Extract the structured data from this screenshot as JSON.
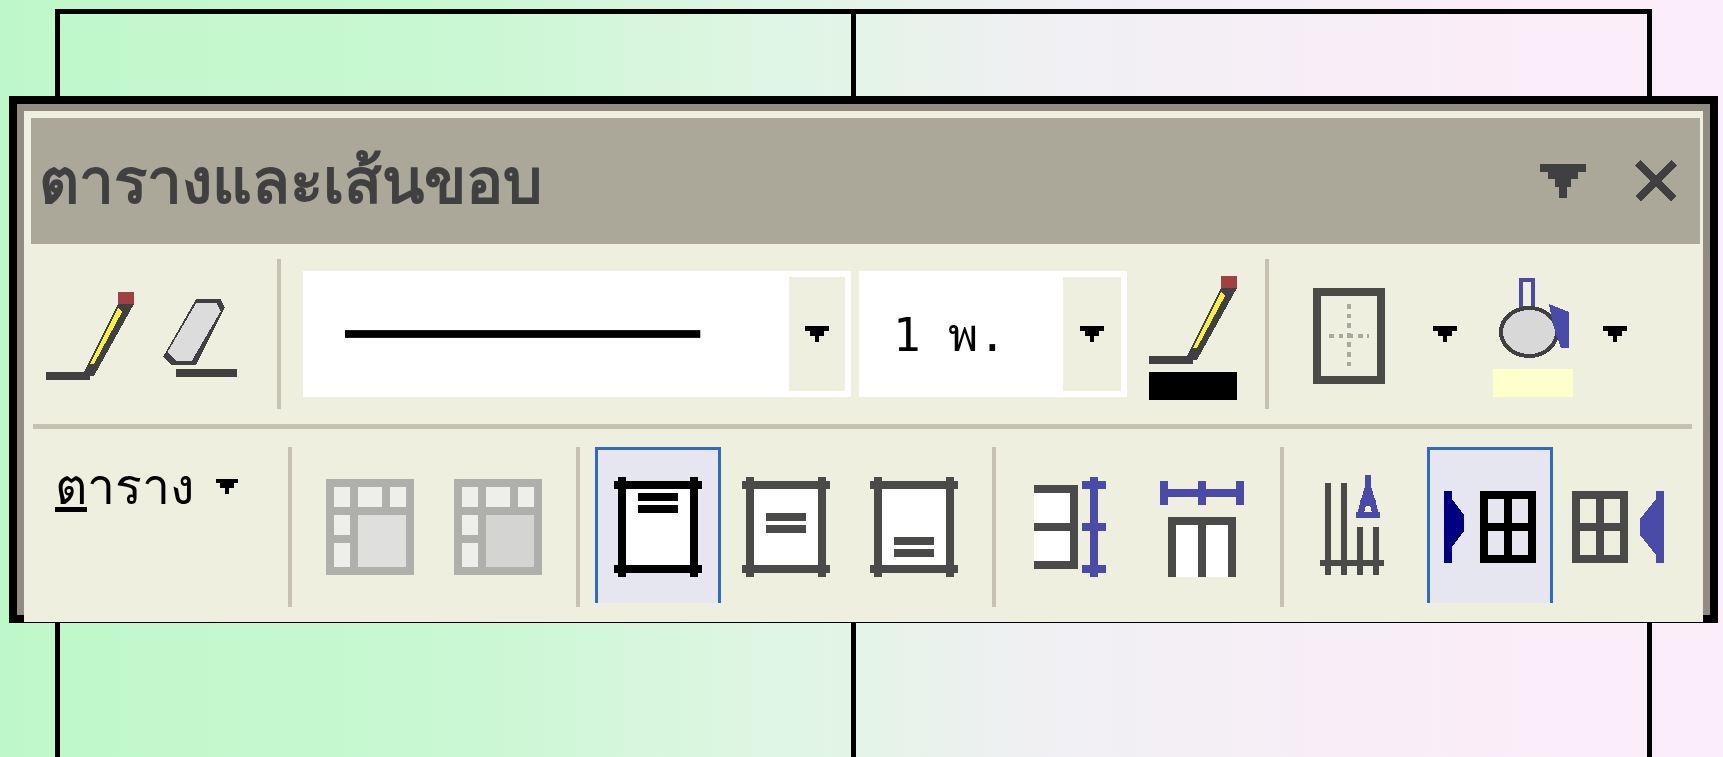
{
  "window": {
    "title": "ตารางและเส้นขอบ"
  },
  "rows": [
    {
      "groups": [
        {
          "items": [
            {
              "kind": "pencil",
              "selected": false,
              "disabled": false
            },
            {
              "kind": "eraser",
              "selected": false,
              "disabled": false
            }
          ]
        },
        {
          "items": [
            {
              "kind": "style"
            },
            {
              "kind": "weight",
              "value": "1 พ."
            },
            {
              "kind": "pen",
              "selected": false,
              "disabled": false,
              "color": "#000000"
            }
          ]
        },
        {
          "items": [
            {
              "kind": "borders",
              "selected": false,
              "disabled": false
            },
            {
              "kind": "shading",
              "selected": false,
              "disabled": false,
              "color": "#ffffcc"
            }
          ]
        }
      ]
    },
    {
      "groups": [
        {
          "items": [
            {
              "kind": "menu",
              "label": "ตาราง"
            }
          ]
        },
        {
          "items": [
            {
              "kind": "merge",
              "selected": false,
              "disabled": true
            },
            {
              "kind": "split",
              "selected": false,
              "disabled": true
            }
          ]
        },
        {
          "items": [
            {
              "kind": "top",
              "selected": true,
              "disabled": false
            },
            {
              "kind": "middle",
              "selected": false,
              "disabled": false
            },
            {
              "kind": "bottom",
              "selected": false,
              "disabled": false
            }
          ]
        },
        {
          "items": [
            {
              "kind": "rows",
              "selected": false,
              "disabled": false
            },
            {
              "kind": "columns",
              "selected": false,
              "disabled": false
            }
          ]
        },
        {
          "items": [
            {
              "kind": "sort",
              "selected": false,
              "disabled": false
            },
            {
              "kind": "left",
              "selected": true,
              "disabled": false
            },
            {
              "kind": "right",
              "selected": false,
              "disabled": false
            }
          ]
        }
      ]
    }
  ]
}
